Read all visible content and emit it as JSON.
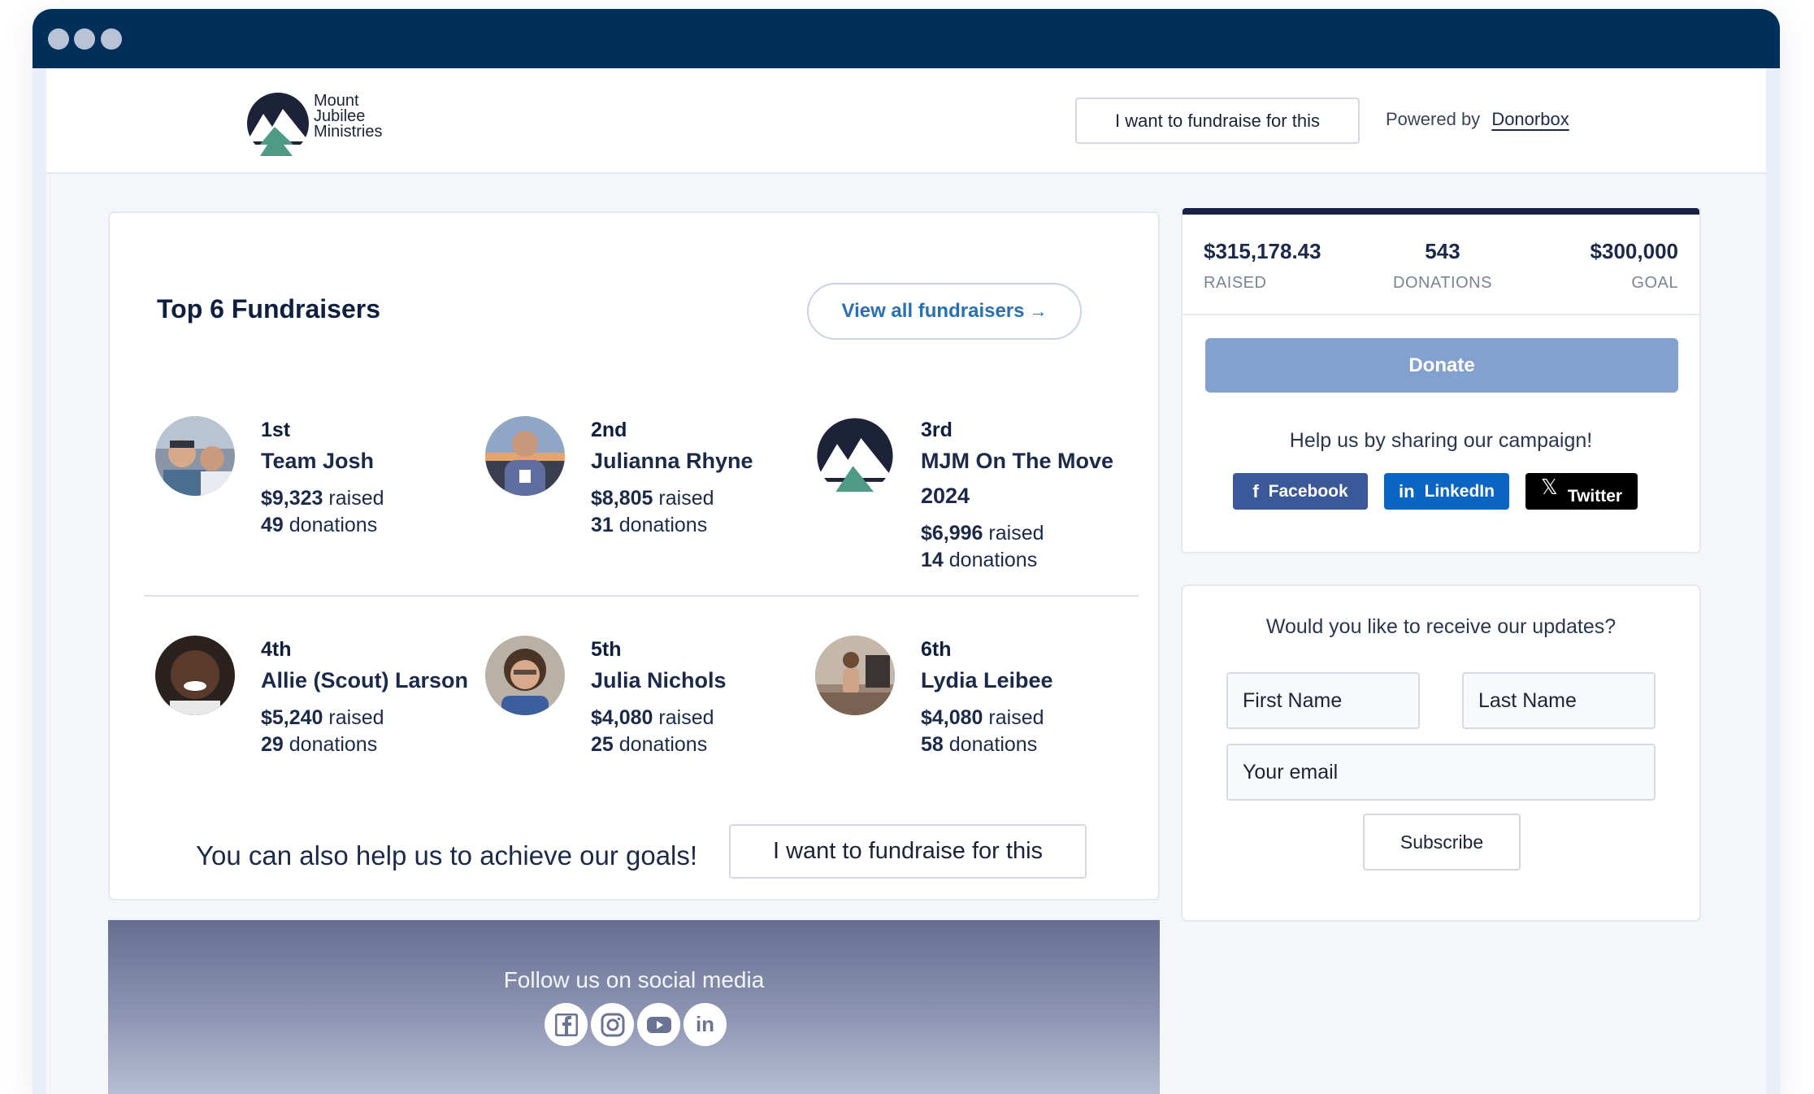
{
  "org": {
    "name_lines": [
      "Mount",
      "Jubilee",
      "Ministries"
    ]
  },
  "nav": {
    "fundraise_label": "I want to fundraise for this",
    "powered_by_label": "Powered by",
    "powered_by_link": "Donorbox"
  },
  "fundraisers": {
    "title": "Top 6 Fundraisers",
    "view_all_label": "View all fundraisers",
    "raised_word": "raised",
    "donations_word": "donations",
    "items": [
      {
        "rank": "1st",
        "name": "Team Josh",
        "raised": "$9,323",
        "donations": "49"
      },
      {
        "rank": "2nd",
        "name": "Julianna Rhyne",
        "raised": "$8,805",
        "donations": "31"
      },
      {
        "rank": "3rd",
        "name": "MJM On The Move 2024",
        "raised": "$6,996",
        "donations": "14"
      },
      {
        "rank": "4th",
        "name": "Allie (Scout) Larson",
        "raised": "$5,240",
        "donations": "29"
      },
      {
        "rank": "5th",
        "name": "Julia Nichols",
        "raised": "$4,080",
        "donations": "25"
      },
      {
        "rank": "6th",
        "name": "Lydia Leibee",
        "raised": "$4,080",
        "donations": "58"
      }
    ],
    "goals_text": "You can also help us to achieve our goals!",
    "goals_button": "I want to fundraise for this"
  },
  "social": {
    "follow_text": "Follow us on social media",
    "icons": [
      "facebook-icon",
      "instagram-icon",
      "youtube-icon",
      "linkedin-icon"
    ]
  },
  "campaign": {
    "raised_value": "$315,178.43",
    "raised_label": "RAISED",
    "donations_value": "543",
    "donations_label": "DONATIONS",
    "goal_value": "$300,000",
    "goal_label": "GOAL",
    "donate_label": "Donate",
    "share_text": "Help us by sharing our campaign!",
    "share_buttons": {
      "facebook": "Facebook",
      "linkedin": "LinkedIn",
      "twitter": "Twitter"
    }
  },
  "subscribe": {
    "title": "Would you like to receive our updates?",
    "first_name_placeholder": "First Name",
    "last_name_placeholder": "Last Name",
    "email_placeholder": "Your email",
    "button_label": "Subscribe"
  },
  "colors": {
    "titlebar": "#00305a",
    "accent_link": "#2771b3",
    "donate_button": "#82a0d0",
    "facebook": "#3b5998",
    "linkedin": "#0a66c2",
    "twitter": "#000000",
    "logo_dark": "#1c2238",
    "logo_green": "#4f9a84"
  }
}
